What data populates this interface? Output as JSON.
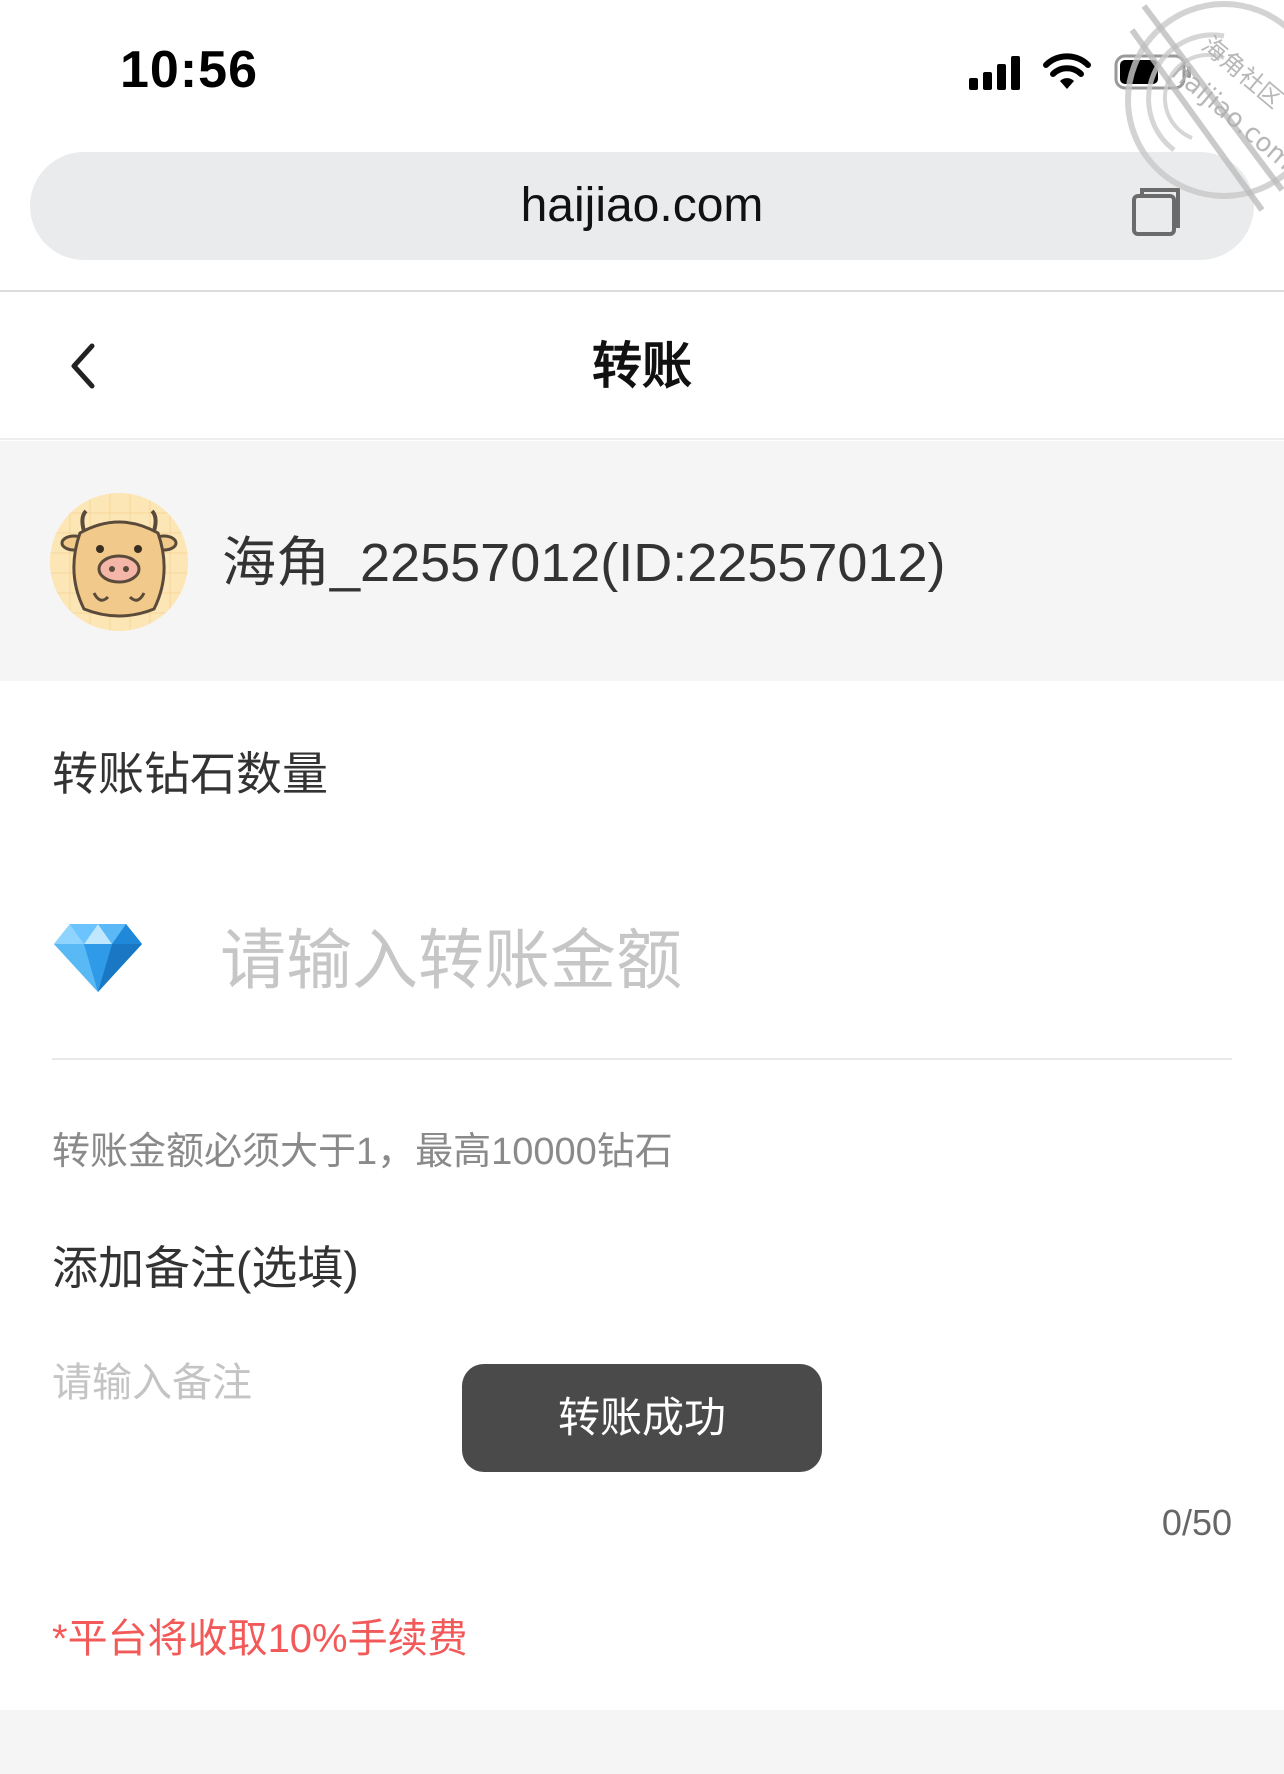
{
  "status_bar": {
    "time": "10:56",
    "icons": [
      "signal-icon",
      "wifi-icon",
      "battery-icon"
    ]
  },
  "browser": {
    "url": "haijiao.com",
    "tabs_icon": "tabs-icon"
  },
  "header": {
    "title": "转账",
    "back_icon": "chevron-left-icon"
  },
  "recipient": {
    "display": "海角_22557012(ID:22557012)",
    "avatar_icon": "cow-avatar"
  },
  "form": {
    "amount_label": "转账钻石数量",
    "amount_placeholder": "请输入转账金额",
    "amount_value": "",
    "amount_icon": "diamond-icon",
    "amount_hint": "转账金额必须大于1，最高10000钻石",
    "note_label": "添加备注(选填)",
    "note_placeholder": "请输入备注",
    "note_value": "",
    "note_counter": "0/50",
    "fee_note": "*平台将收取10%手续费"
  },
  "toast": {
    "message": "转账成功"
  },
  "watermark": {
    "site": "haijiao.com",
    "name": "海角社区"
  },
  "colors": {
    "accent_red": "#f25a5a",
    "toast_bg": "#4a4a4a",
    "section_bg": "#f5f5f5",
    "address_bar_bg": "#e9ebed"
  }
}
